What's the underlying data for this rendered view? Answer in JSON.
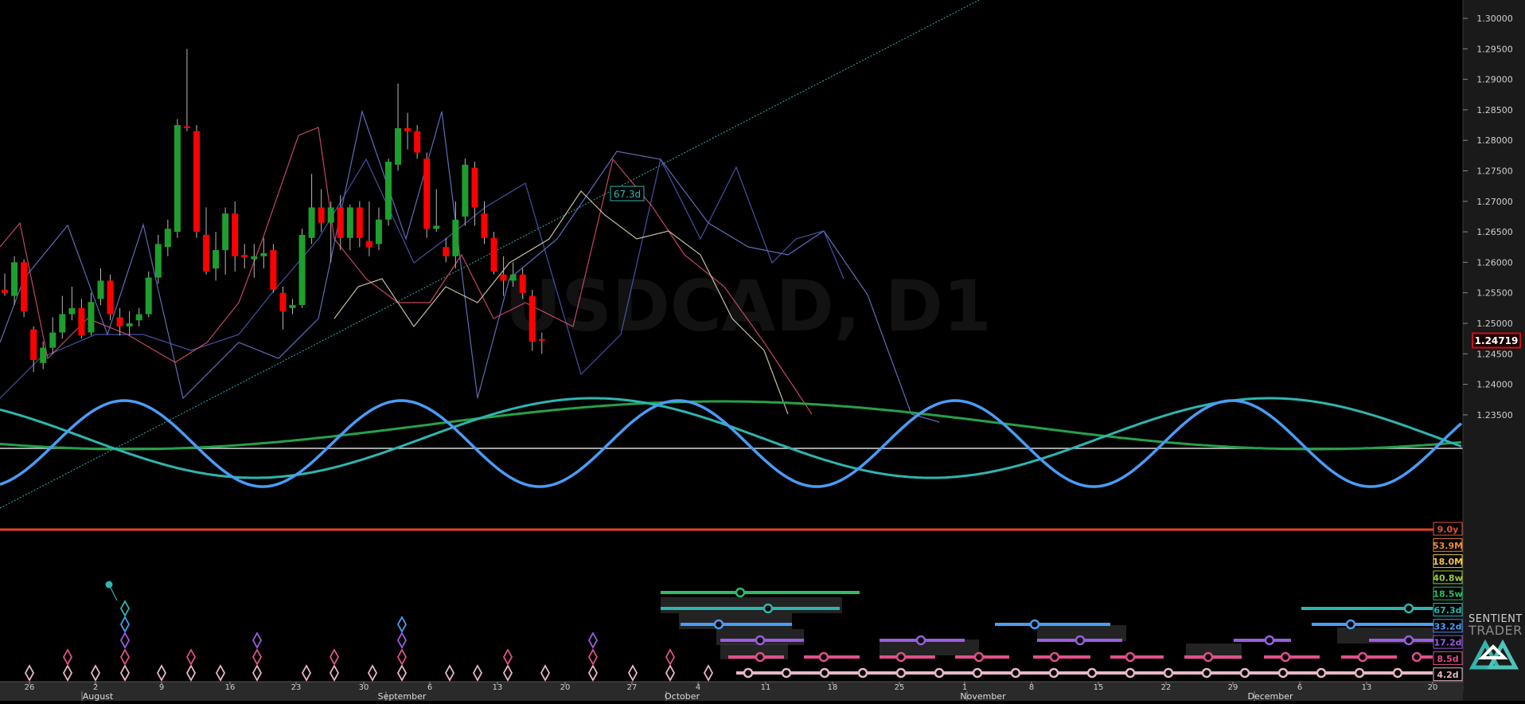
{
  "chart_data": {
    "type": "candlestick",
    "watermark": "USDCAD, D1",
    "price_axis": {
      "ticks": [
        1.3,
        1.295,
        1.29,
        1.285,
        1.28,
        1.275,
        1.27,
        1.265,
        1.26,
        1.255,
        1.25,
        1.245,
        1.24,
        1.235
      ],
      "current_price": 1.24719
    },
    "day_ticks": [
      "26",
      "2",
      "9",
      "16",
      "23",
      "30",
      "6",
      "13",
      "20",
      "27",
      "4",
      "11",
      "18",
      "25",
      "1",
      "8",
      "15",
      "22",
      "29",
      "6",
      "13",
      "20"
    ],
    "month_labels": [
      "August",
      "September",
      "October",
      "November",
      "December"
    ],
    "candles": [
      {
        "o": 1.2555,
        "h": 1.2582,
        "l": 1.2545,
        "c": 1.255
      },
      {
        "o": 1.2545,
        "h": 1.261,
        "l": 1.253,
        "c": 1.26
      },
      {
        "o": 1.26,
        "h": 1.2605,
        "l": 1.251,
        "c": 1.252
      },
      {
        "o": 1.249,
        "h": 1.2495,
        "l": 1.242,
        "c": 1.244
      },
      {
        "o": 1.2435,
        "h": 1.247,
        "l": 1.2425,
        "c": 1.246
      },
      {
        "o": 1.246,
        "h": 1.251,
        "l": 1.245,
        "c": 1.2485
      },
      {
        "o": 1.2485,
        "h": 1.2545,
        "l": 1.2475,
        "c": 1.2515
      },
      {
        "o": 1.2515,
        "h": 1.256,
        "l": 1.2505,
        "c": 1.2525
      },
      {
        "o": 1.2525,
        "h": 1.254,
        "l": 1.2475,
        "c": 1.248
      },
      {
        "o": 1.2485,
        "h": 1.255,
        "l": 1.248,
        "c": 1.2535
      },
      {
        "o": 1.254,
        "h": 1.259,
        "l": 1.253,
        "c": 1.257
      },
      {
        "o": 1.257,
        "h": 1.258,
        "l": 1.2505,
        "c": 1.2515
      },
      {
        "o": 1.251,
        "h": 1.2525,
        "l": 1.248,
        "c": 1.2495
      },
      {
        "o": 1.2495,
        "h": 1.252,
        "l": 1.248,
        "c": 1.25
      },
      {
        "o": 1.2505,
        "h": 1.2525,
        "l": 1.2495,
        "c": 1.2515
      },
      {
        "o": 1.2515,
        "h": 1.2585,
        "l": 1.251,
        "c": 1.2575
      },
      {
        "o": 1.2575,
        "h": 1.2645,
        "l": 1.2565,
        "c": 1.263
      },
      {
        "o": 1.2625,
        "h": 1.267,
        "l": 1.261,
        "c": 1.2655
      },
      {
        "o": 1.265,
        "h": 1.2835,
        "l": 1.264,
        "c": 1.2825
      },
      {
        "o": 1.2823,
        "h": 1.295,
        "l": 1.2815,
        "c": 1.282
      },
      {
        "o": 1.2815,
        "h": 1.2825,
        "l": 1.264,
        "c": 1.265
      },
      {
        "o": 1.2645,
        "h": 1.269,
        "l": 1.258,
        "c": 1.2585
      },
      {
        "o": 1.259,
        "h": 1.265,
        "l": 1.257,
        "c": 1.262
      },
      {
        "o": 1.262,
        "h": 1.269,
        "l": 1.258,
        "c": 1.268
      },
      {
        "o": 1.268,
        "h": 1.27,
        "l": 1.2585,
        "c": 1.261
      },
      {
        "o": 1.2612,
        "h": 1.263,
        "l": 1.259,
        "c": 1.2608
      },
      {
        "o": 1.2605,
        "h": 1.263,
        "l": 1.2575,
        "c": 1.261
      },
      {
        "o": 1.261,
        "h": 1.264,
        "l": 1.259,
        "c": 1.2615
      },
      {
        "o": 1.262,
        "h": 1.263,
        "l": 1.255,
        "c": 1.2555
      },
      {
        "o": 1.255,
        "h": 1.256,
        "l": 1.249,
        "c": 1.252
      },
      {
        "o": 1.2525,
        "h": 1.254,
        "l": 1.2515,
        "c": 1.253
      },
      {
        "o": 1.253,
        "h": 1.2655,
        "l": 1.2525,
        "c": 1.2645
      },
      {
        "o": 1.264,
        "h": 1.2745,
        "l": 1.263,
        "c": 1.269
      },
      {
        "o": 1.269,
        "h": 1.272,
        "l": 1.265,
        "c": 1.2665
      },
      {
        "o": 1.2665,
        "h": 1.27,
        "l": 1.26,
        "c": 1.269
      },
      {
        "o": 1.269,
        "h": 1.271,
        "l": 1.262,
        "c": 1.264
      },
      {
        "o": 1.264,
        "h": 1.2695,
        "l": 1.262,
        "c": 1.269
      },
      {
        "o": 1.269,
        "h": 1.27,
        "l": 1.2625,
        "c": 1.264
      },
      {
        "o": 1.2635,
        "h": 1.27,
        "l": 1.261,
        "c": 1.2625
      },
      {
        "o": 1.263,
        "h": 1.269,
        "l": 1.262,
        "c": 1.267
      },
      {
        "o": 1.267,
        "h": 1.277,
        "l": 1.266,
        "c": 1.2765
      },
      {
        "o": 1.276,
        "h": 1.2893,
        "l": 1.275,
        "c": 1.282
      },
      {
        "o": 1.282,
        "h": 1.2845,
        "l": 1.2785,
        "c": 1.2815
      },
      {
        "o": 1.2815,
        "h": 1.2825,
        "l": 1.277,
        "c": 1.278
      },
      {
        "o": 1.277,
        "h": 1.278,
        "l": 1.264,
        "c": 1.2655
      },
      {
        "o": 1.2655,
        "h": 1.272,
        "l": 1.265,
        "c": 1.266
      },
      {
        "o": 1.2625,
        "h": 1.264,
        "l": 1.26,
        "c": 1.261
      },
      {
        "o": 1.261,
        "h": 1.27,
        "l": 1.259,
        "c": 1.267
      },
      {
        "o": 1.2675,
        "h": 1.277,
        "l": 1.266,
        "c": 1.276
      },
      {
        "o": 1.2755,
        "h": 1.2765,
        "l": 1.266,
        "c": 1.269
      },
      {
        "o": 1.268,
        "h": 1.27,
        "l": 1.263,
        "c": 1.264
      },
      {
        "o": 1.264,
        "h": 1.265,
        "l": 1.258,
        "c": 1.2585
      },
      {
        "o": 1.258,
        "h": 1.261,
        "l": 1.2545,
        "c": 1.257
      },
      {
        "o": 1.257,
        "h": 1.26,
        "l": 1.256,
        "c": 1.258
      },
      {
        "o": 1.258,
        "h": 1.259,
        "l": 1.254,
        "c": 1.255
      },
      {
        "o": 1.2545,
        "h": 1.2555,
        "l": 1.2455,
        "c": 1.247
      },
      {
        "o": 1.2474,
        "h": 1.2485,
        "l": 1.245,
        "c": 1.2472
      }
    ],
    "cycle_labels": [
      {
        "label": "9.0y",
        "color": "#e0573a"
      },
      {
        "label": "53.9M",
        "color": "#f08a3c"
      },
      {
        "label": "18.0M",
        "color": "#f2c44a"
      },
      {
        "label": "40.8w",
        "color": "#9ccc3f"
      },
      {
        "label": "18.5w",
        "color": "#2ebd62"
      },
      {
        "label": "67.3d",
        "color": "#2fb5b0"
      },
      {
        "label": "33.2d",
        "color": "#4a9cf5"
      },
      {
        "label": "17.2d",
        "color": "#9b5de0"
      },
      {
        "label": "8.5d",
        "color": "#e0508c"
      },
      {
        "label": "4.2d",
        "color": "#e8b8c8"
      }
    ],
    "annotation": "67.3d",
    "colors": {
      "up": "#1e9e2e",
      "down": "#ff0000",
      "price_marker": "#cc1010",
      "trend_line": "#2fb5b0"
    }
  },
  "branding": {
    "line1": "SENTIENT",
    "line2": "TRADER"
  }
}
